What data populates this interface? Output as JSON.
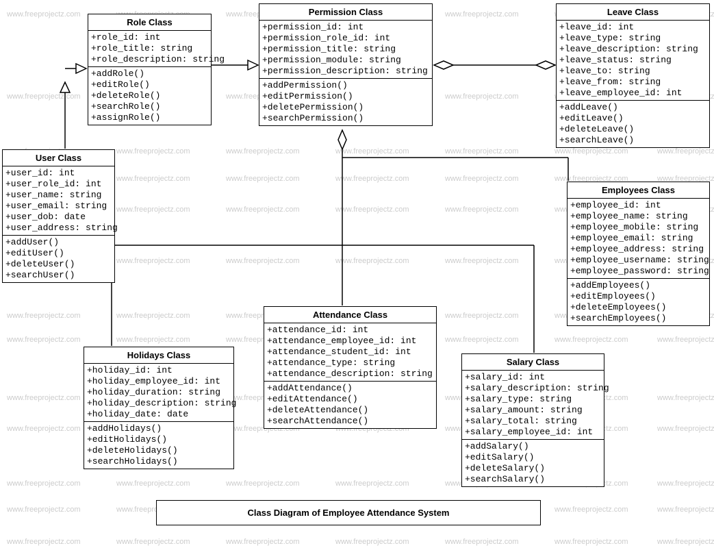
{
  "watermark_text": "www.freeprojectz.com",
  "title": "Class Diagram of Employee Attendance System",
  "classes": {
    "role": {
      "name": "Role Class",
      "attrs": [
        "+role_id: int",
        "+role_title: string",
        "+role_description: string"
      ],
      "methods": [
        "+addRole()",
        "+editRole()",
        "+deleteRole()",
        "+searchRole()",
        "+assignRole()"
      ]
    },
    "permission": {
      "name": "Permission Class",
      "attrs": [
        "+permission_id: int",
        "+permission_role_id: int",
        "+permission_title: string",
        "+permission_module: string",
        "+permission_description: string"
      ],
      "methods": [
        "+addPermission()",
        "+editPermission()",
        "+deletePermission()",
        "+searchPermission()"
      ]
    },
    "leave": {
      "name": "Leave Class",
      "attrs": [
        "+leave_id: int",
        "+leave_type: string",
        "+leave_description: string",
        "+leave_status: string",
        "+leave_to: string",
        "+leave_from: string",
        "+leave_employee_id: int"
      ],
      "methods": [
        "+addLeave()",
        "+editLeave()",
        "+deleteLeave()",
        "+searchLeave()"
      ]
    },
    "user": {
      "name": "User Class",
      "attrs": [
        "+user_id: int",
        "+user_role_id: int",
        "+user_name: string",
        "+user_email: string",
        "+user_dob: date",
        "+user_address: string"
      ],
      "methods": [
        "+addUser()",
        "+editUser()",
        "+deleteUser()",
        "+searchUser()"
      ]
    },
    "employees": {
      "name": "Employees Class",
      "attrs": [
        "+employee_id: int",
        "+employee_name: string",
        "+employee_mobile: string",
        "+employee_email: string",
        "+employee_address: string",
        "+employee_username: string",
        "+employee_password: string"
      ],
      "methods": [
        "+addEmployees()",
        "+editEmployees()",
        "+deleteEmployees()",
        "+searchEmployees()"
      ]
    },
    "holidays": {
      "name": "Holidays Class",
      "attrs": [
        "+holiday_id: int",
        "+holiday_employee_id: int",
        "+holiday_duration: string",
        "+holiday_description: string",
        "+holiday_date: date"
      ],
      "methods": [
        "+addHolidays()",
        "+editHolidays()",
        "+deleteHolidays()",
        "+searchHolidays()"
      ]
    },
    "attendance": {
      "name": "Attendance Class",
      "attrs": [
        "+attendance_id: int",
        "+attendance_employee_id: int",
        "+attendance_student_id: int",
        "+attendance_type: string",
        "+attendance_description: string"
      ],
      "methods": [
        "+addAttendance()",
        "+editAttendance()",
        "+deleteAttendance()",
        "+searchAttendance()"
      ]
    },
    "salary": {
      "name": "Salary Class",
      "attrs": [
        "+salary_id: int",
        "+salary_description: string",
        "+salary_type: string",
        "+salary_amount: string",
        "+salary_total: string",
        "+salary_employee_id: int"
      ],
      "methods": [
        "+addSalary()",
        "+editSalary()",
        "+deleteSalary()",
        "+searchSalary()"
      ]
    }
  }
}
